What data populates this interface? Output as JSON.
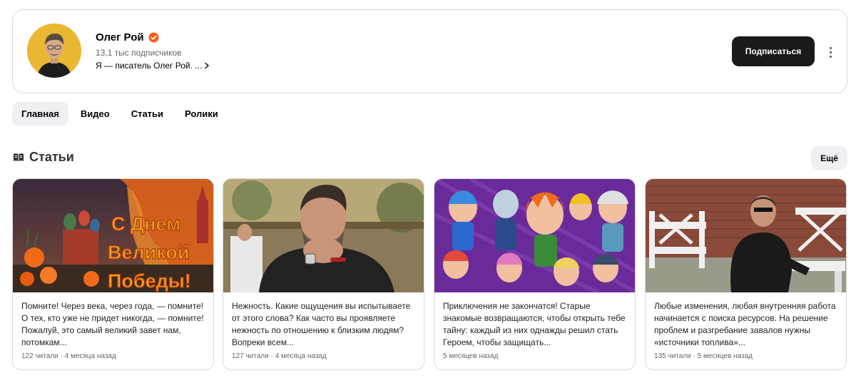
{
  "channel": {
    "name": "Олег Рой",
    "subscribers": "13,1 тыс подписчиков",
    "description": "Я — писатель Олег Рой. ...",
    "subscribe_label": "Подписаться"
  },
  "tabs": [
    {
      "label": "Главная",
      "active": true
    },
    {
      "label": "Видео",
      "active": false
    },
    {
      "label": "Статьи",
      "active": false
    },
    {
      "label": "Ролики",
      "active": false
    }
  ],
  "section": {
    "title": "Статьи",
    "more_label": "Ещё"
  },
  "articles": [
    {
      "image_text": "С Днем Великой Победы!",
      "text": "Помните! Через века, через года, — помните! О тех, кто уже не придет никогда, — помните! Пожалуй, это самый великий завет нам, потомкам...",
      "meta": "122 читали · 4 месяца назад"
    },
    {
      "text": "Нежность. Какие ощущения вы испытываете от этого слова? Как часто вы проявляете нежность по отношению к близким людям? Вопреки всем...",
      "meta": "127 читали · 4 месяца назад"
    },
    {
      "text": "Приключения не закончатся! Старые знакомые возвращаются, чтобы открыть тебе тайну: каждый из них однажды решил стать Героем, чтобы защищать...",
      "meta": "5 месяцев назад"
    },
    {
      "text": "Любые изменения, любая внутренняя работа начинается с поиска ресурсов. На решение проблем и разгребание завалов нужны «источники топлива»...",
      "meta": "135 читали · 5 месяцев назад"
    }
  ],
  "colors": {
    "verified": "#fc5a1a",
    "button_dark": "#1a1a1a",
    "tab_active_bg": "#eef0f4"
  }
}
